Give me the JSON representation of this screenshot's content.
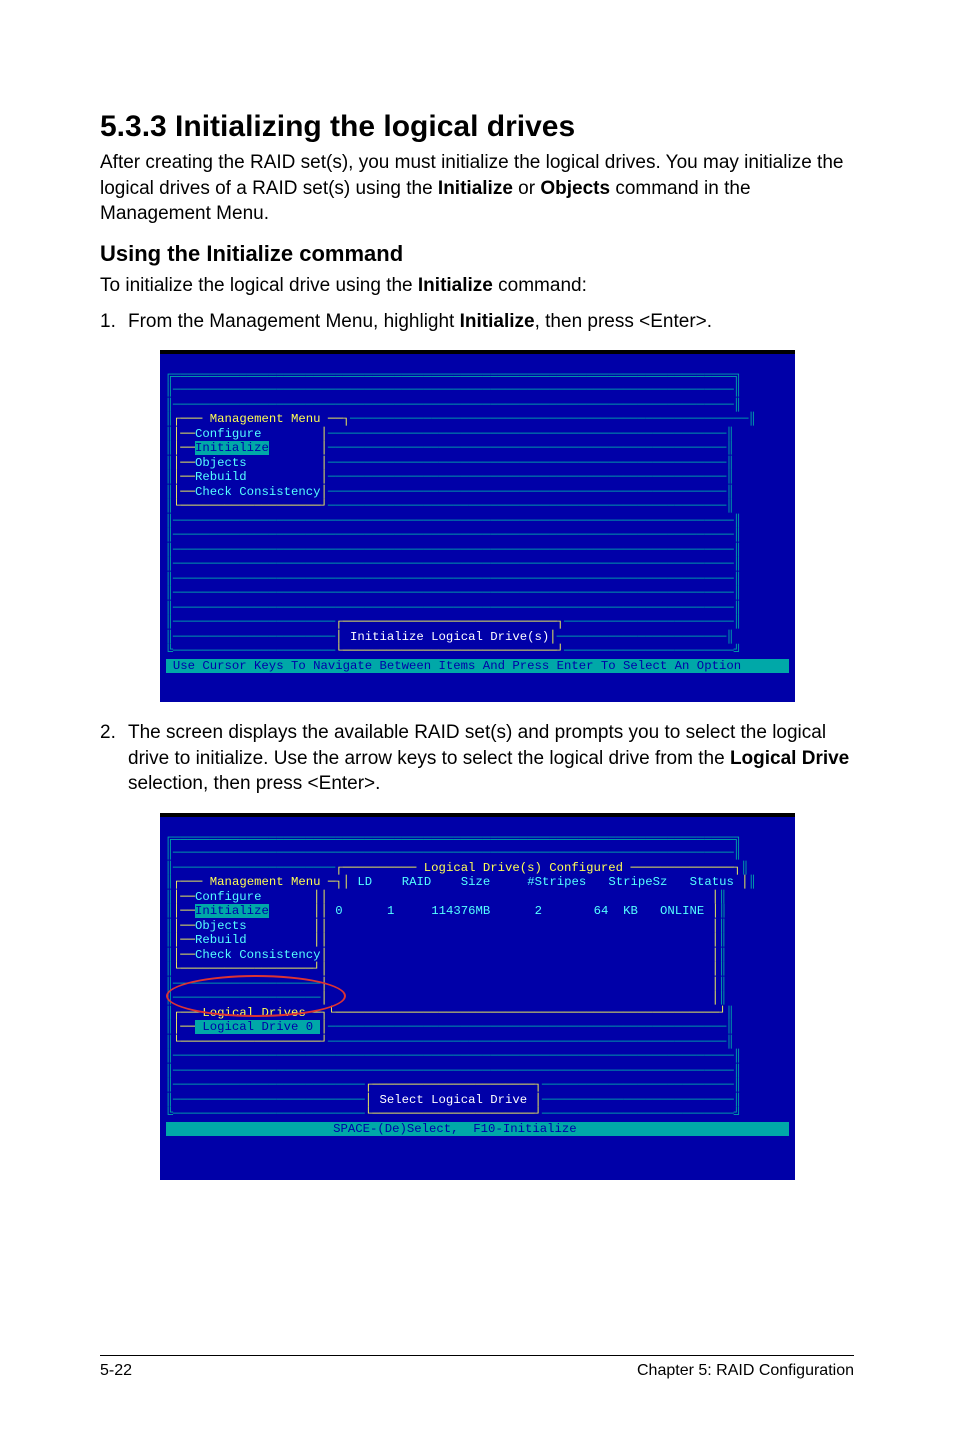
{
  "heading": "5.3.3  Initializing the logical drives",
  "intro_a": "After creating the RAID set(s), you must initialize the logical drives. You may initialize the logical drives of a RAID set(s) using the ",
  "intro_b": "Initialize",
  "intro_c": " or ",
  "intro_d": "Objects",
  "intro_e": " command in the Management Menu.",
  "subheading": "Using the Initialize command",
  "lead_a": "To initialize the logical drive using the ",
  "lead_b": "Initialize",
  "lead_c": " command:",
  "step1": {
    "num": "1.",
    "a": "From the Management Menu, highlight ",
    "b": "Initialize",
    "c": ", then press <Enter>."
  },
  "step2": {
    "num": "2.",
    "a": "The screen displays the available RAID set(s) and prompts you to select the logical drive to initialize. Use the arrow keys to select the logical drive from the ",
    "b": "Logical Drive",
    "c": " selection, then press <Enter>."
  },
  "term1": {
    "menu_title": " Management Menu ",
    "items": [
      "Configure",
      "Initialize",
      "Objects",
      "Rebuild",
      "Check Consistency"
    ],
    "action": " Initialize Logical Drive(s)",
    "status": " Use Cursor Keys To Navigate Between Items And Press Enter To Select An Option "
  },
  "term2": {
    "menu_title": " Management Menu ",
    "items": [
      "Configure",
      "Initialize",
      "Objects",
      "Rebuild",
      "Check Consistency"
    ],
    "panel_title": " Logical Drive(s) Configured ",
    "cols": {
      "ld": "LD",
      "raid": "RAID",
      "size": "Size",
      "stripes": "#Stripes",
      "stripesz": "StripeSz",
      "status": "Status"
    },
    "row": {
      "ld": "0",
      "raid": "1",
      "size": "114376MB",
      "stripes": "2",
      "stripesz": "64  KB",
      "status": "ONLINE"
    },
    "logical_drives_label": "Logical Drives",
    "logical_drive_item": " Logical Drive 0 ",
    "action": " Select Logical Drive ",
    "status": "SPACE-(De)Select,  F10-Initialize"
  },
  "footer": {
    "left": "5-22",
    "right": "Chapter 5: RAID Configuration"
  },
  "fill": "══════════════════════════════════════════════════════════════════════════════════════════════════════════"
}
